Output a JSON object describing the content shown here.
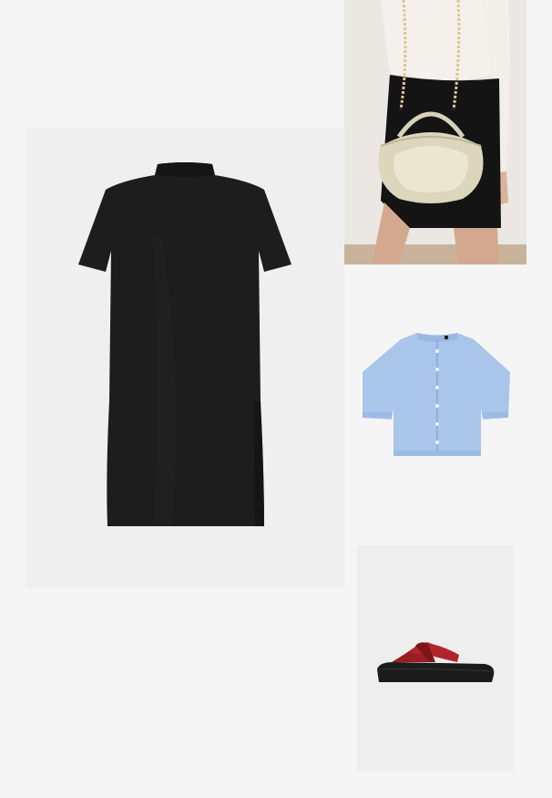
{
  "items": [
    {
      "name": "dress",
      "color": "#1b1b1b"
    },
    {
      "name": "bag",
      "color": "#d9d3b8"
    },
    {
      "name": "cardigan",
      "color": "#a9c6ea"
    },
    {
      "name": "sandal",
      "color": "#9e1f24"
    }
  ]
}
